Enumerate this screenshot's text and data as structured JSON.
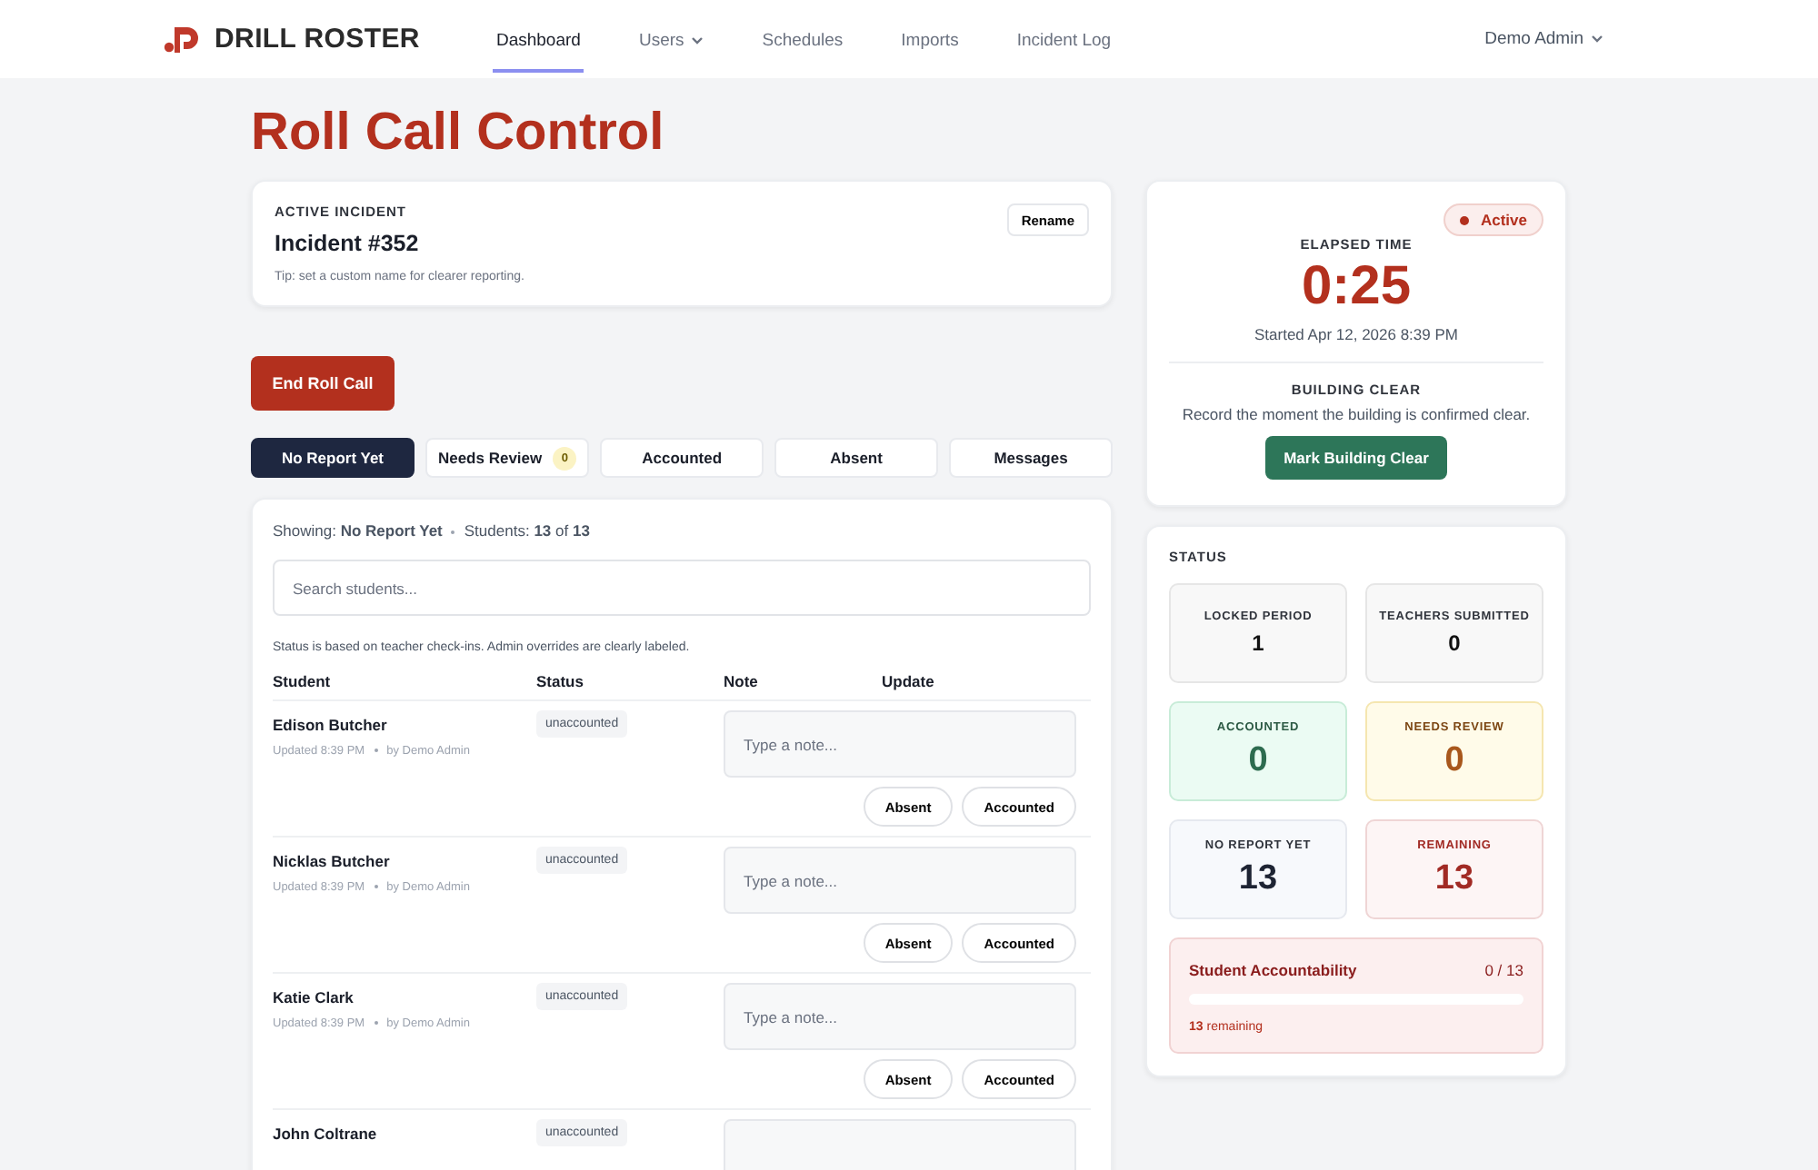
{
  "brand": "DRILL ROSTER",
  "nav": [
    {
      "label": "Dashboard",
      "selected": true
    },
    {
      "label": "Users",
      "selected": false,
      "menu": true
    },
    {
      "label": "Schedules",
      "selected": false
    },
    {
      "label": "Imports",
      "selected": false
    },
    {
      "label": "Incident Log",
      "selected": false
    }
  ],
  "user_menu": "Demo Admin",
  "page_title": "Roll Call Control",
  "incident": {
    "label": "ACTIVE INCIDENT",
    "name": "Incident #352",
    "tip": "Tip: set a custom name for clearer reporting.",
    "button": "Rename"
  },
  "end_button": "End Roll Call",
  "filter_tabs": [
    {
      "label": "No Report Yet",
      "selected": true
    },
    {
      "label": "Needs Review",
      "selected": false,
      "count": "0"
    },
    {
      "label": "Accounted",
      "selected": false
    },
    {
      "label": "Absent",
      "selected": false
    },
    {
      "label": "Messages",
      "selected": false
    }
  ],
  "list": {
    "showing_label": "Showing:",
    "showing_value": "No Report Yet",
    "students_label": "Students:",
    "students_count": "13",
    "students_of": "of",
    "students_total": "13",
    "search": {
      "placeholder": "Search students..."
    },
    "note": "Status is based on teacher check-ins. Admin overrides are clearly labeled.",
    "columns": [
      "Student",
      "Status",
      "Note",
      "Update"
    ],
    "rows": [
      {
        "name": "Edison Butcher",
        "updated": "Updated 8:39 PM",
        "by": "by Demo Admin",
        "status": "unaccounted",
        "placeholder": "Type a note...",
        "actions": [
          "Absent",
          "Accounted"
        ]
      },
      {
        "name": "Nicklas Butcher",
        "updated": "Updated 8:39 PM",
        "by": "by Demo Admin",
        "status": "unaccounted",
        "placeholder": "Type a note...",
        "actions": [
          "Absent",
          "Accounted"
        ]
      },
      {
        "name": "Katie Clark",
        "updated": "Updated 8:39 PM",
        "by": "by Demo Admin",
        "status": "unaccounted",
        "placeholder": "Type a note...",
        "actions": [
          "Absent",
          "Accounted"
        ]
      },
      {
        "name": "John Coltrane",
        "status": "unaccounted"
      }
    ]
  },
  "timer": {
    "badge": "Active",
    "label": "ELAPSED TIME",
    "time": "0:25",
    "started": "Started Apr 12, 2026 8:39 PM",
    "clear_label": "BUILDING CLEAR",
    "clear_text": "Record the moment the building is confirmed clear.",
    "clear_button": "Mark Building Clear"
  },
  "status": {
    "title": "STATUS",
    "cards": [
      {
        "label": "LOCKED PERIOD",
        "value": "1",
        "kind": "plain"
      },
      {
        "label": "TEACHERS SUBMITTED",
        "value": "0",
        "kind": "plain"
      },
      {
        "label": "ACCOUNTED",
        "value": "0",
        "kind": "good"
      },
      {
        "label": "NEEDS REVIEW",
        "value": "0",
        "kind": "warn"
      },
      {
        "label": "NO REPORT YET",
        "value": "13",
        "kind": "info"
      },
      {
        "label": "REMAINING",
        "value": "13",
        "kind": "alert"
      }
    ],
    "progress": {
      "title": "Student Accountability",
      "reading": "0 / 13",
      "level": 0,
      "remaining_count": "13",
      "remaining_label": "remaining"
    }
  }
}
